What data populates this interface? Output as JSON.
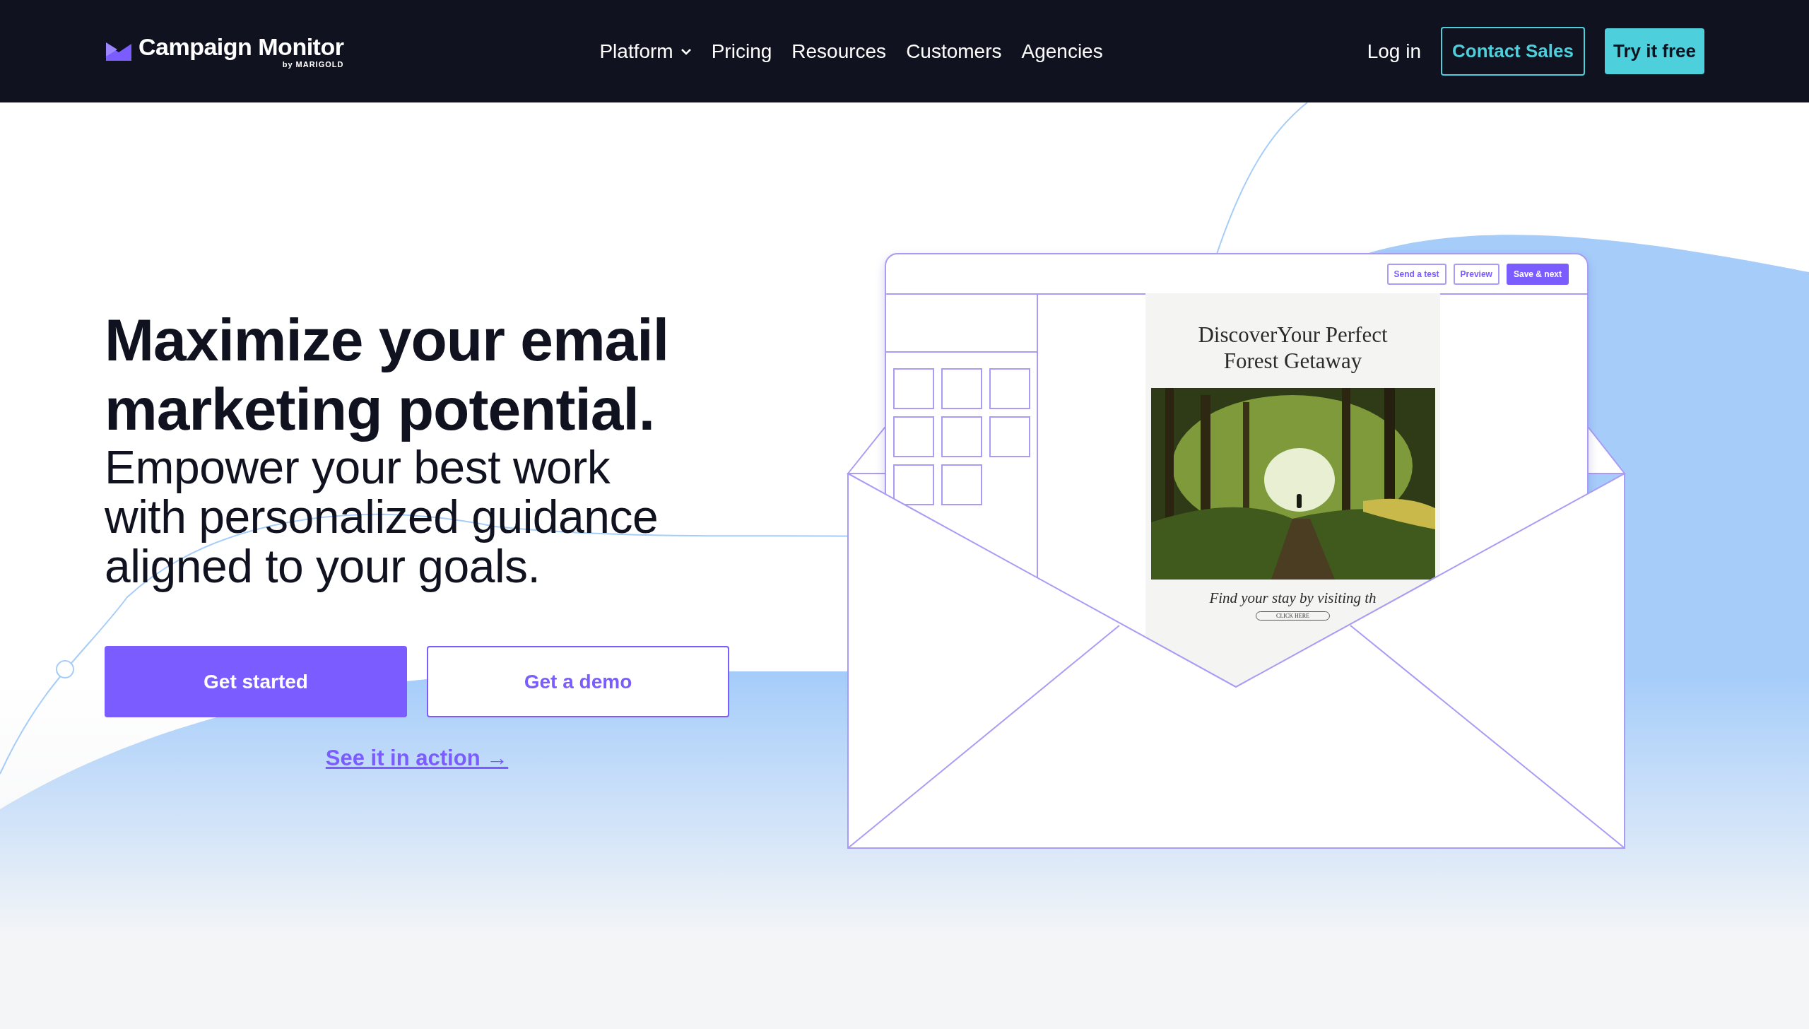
{
  "header": {
    "logo": {
      "name": "Campaign Monitor",
      "byline": "by MARIGOLD"
    },
    "nav": [
      {
        "label": "Platform",
        "dropdown": true
      },
      {
        "label": "Pricing",
        "dropdown": false
      },
      {
        "label": "Resources",
        "dropdown": false
      },
      {
        "label": "Customers",
        "dropdown": false
      },
      {
        "label": "Agencies",
        "dropdown": false
      }
    ],
    "actions": [
      {
        "label": "Log in",
        "kind": "link"
      },
      {
        "label": "Contact Sales",
        "kind": "outline"
      },
      {
        "label": "Try it free",
        "kind": "filled"
      }
    ]
  },
  "hero": {
    "heading": [
      "Maximize your email",
      "marketing potential."
    ],
    "subheading": [
      "Empower your best work",
      "with personalized guidance",
      "aligned to your goals."
    ],
    "buttons": [
      {
        "label": "Get started",
        "kind": "primary"
      },
      {
        "label": "Get a demo",
        "kind": "secondary"
      }
    ],
    "link": "See it in action →"
  },
  "illustration": {
    "toolbar_buttons": [
      {
        "label": "Send a test",
        "kind": "outline"
      },
      {
        "label": "Preview",
        "kind": "outline"
      },
      {
        "label": "Save & next",
        "kind": "filled"
      }
    ],
    "email": {
      "title": [
        "DiscoverYour Perfect",
        "Forest Getaway"
      ],
      "image": {
        "kind": "picture"
      },
      "body": "Find your stay by visiting th",
      "button": "CLICK HERE"
    }
  }
}
